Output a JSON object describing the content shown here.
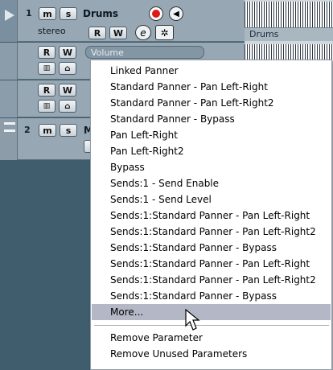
{
  "tracks": {
    "drums": {
      "number": "1",
      "mute_label": "m",
      "solo_label": "s",
      "name": "Drums",
      "config": "stereo",
      "read_label": "R",
      "write_label": "W",
      "edit_label": "e"
    },
    "automation1": {
      "read_label": "R",
      "write_label": "W",
      "param_value": "Volume"
    },
    "automation2": {
      "read_label": "R",
      "write_label": "W"
    },
    "track2": {
      "number": "2",
      "mute_label": "m",
      "solo_label": "s",
      "name_fragment": "M"
    }
  },
  "event_lane": {
    "label": "Drums"
  },
  "context_menu": {
    "items": [
      "Linked Panner",
      "Standard Panner - Pan Left-Right",
      "Standard Panner - Pan Left-Right2",
      "Standard Panner - Bypass",
      "Pan Left-Right",
      "Pan Left-Right2",
      "Bypass",
      "Sends:1 - Send Enable",
      "Sends:1 - Send Level",
      "Sends:1:Standard Panner - Pan Left-Right",
      "Sends:1:Standard Panner - Pan Left-Right2",
      "Sends:1:Standard Panner - Bypass",
      "Sends:1:Standard Panner - Pan Left-Right",
      "Sends:1:Standard Panner - Pan Left-Right2",
      "Sends:1:Standard Panner - Bypass",
      "More..."
    ],
    "highlighted_item": "More...",
    "bottom_items": [
      "Remove Parameter",
      "Remove Unused Parameters"
    ]
  },
  "colors": {
    "record_button": "#e01818",
    "menu_highlight": "#b4b7c6",
    "track_background": "#97a8b4"
  },
  "icons": [
    "play-triangle-icon",
    "record-icon",
    "monitor-speaker-icon",
    "edit-e-icon",
    "settings-icon",
    "lane-toggle-icon",
    "folder-icon",
    "mouse-pointer-icon"
  ]
}
